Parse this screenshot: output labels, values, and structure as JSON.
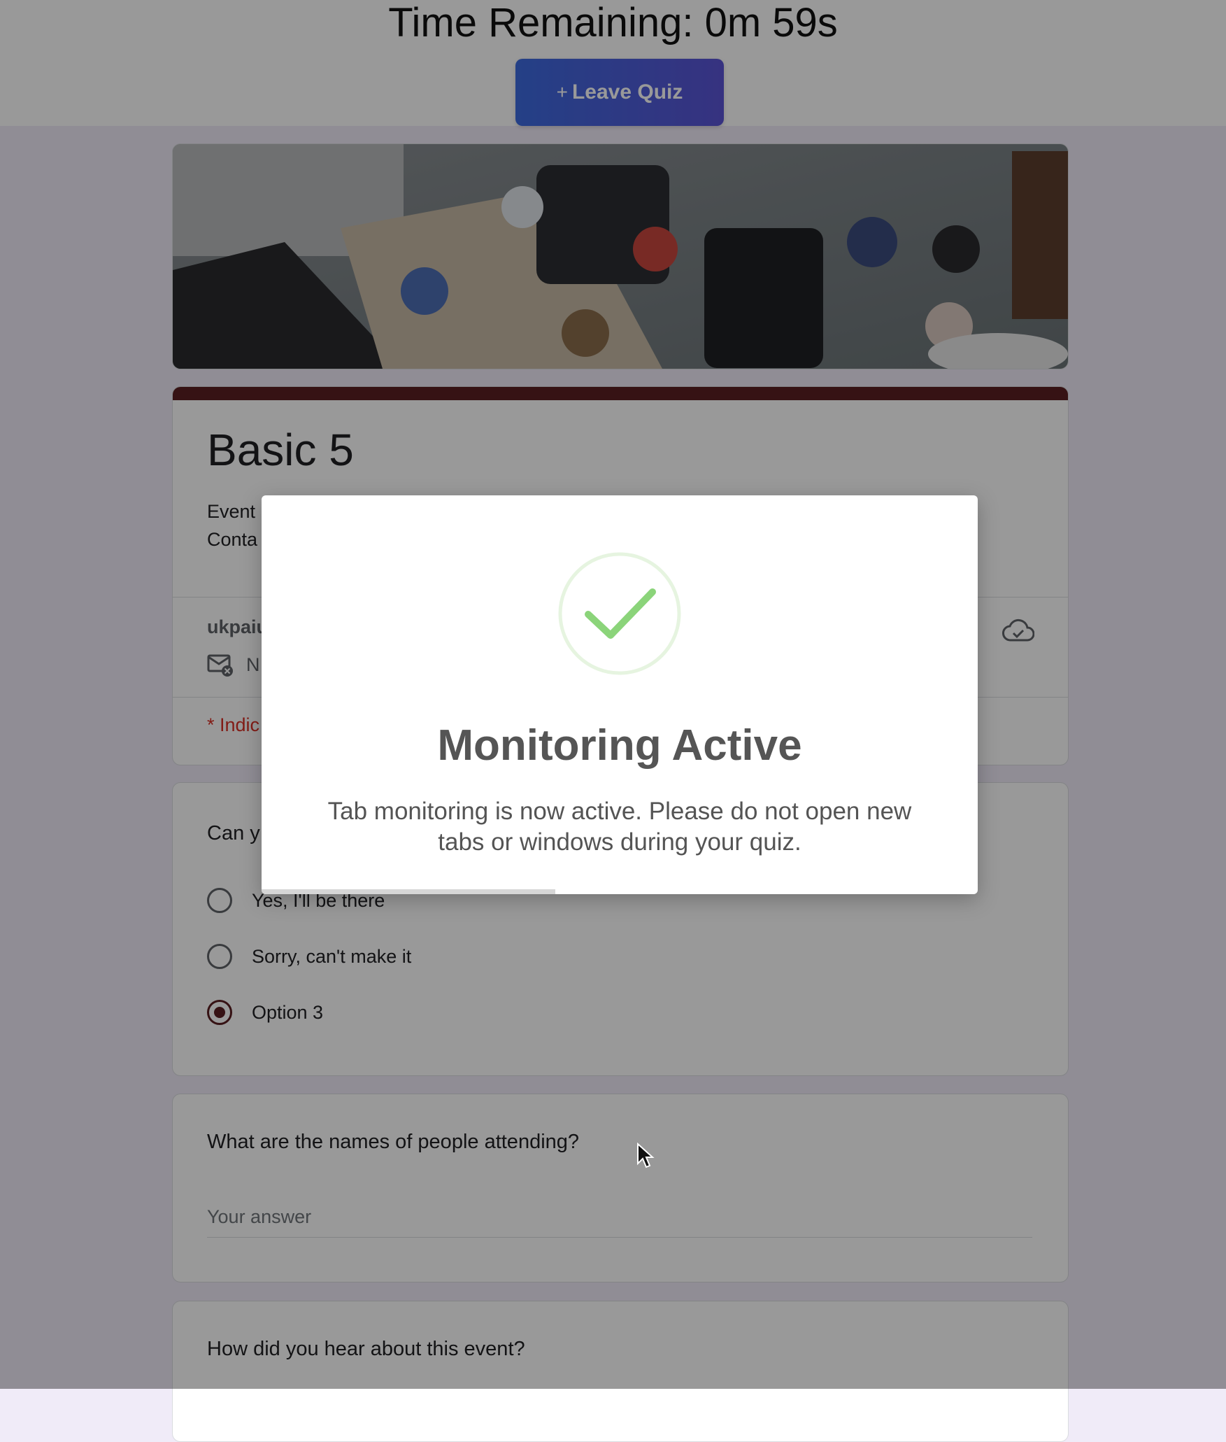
{
  "timer": {
    "text": "Time Remaining: 0m 59s"
  },
  "leave_button": {
    "plus": "+",
    "label": "Leave Quiz"
  },
  "form": {
    "title": "Basic 5",
    "description_visible": "Event\nConta",
    "account_visible": "ukpaiu",
    "email_note_visible": "N",
    "required_note_visible": "* Indic"
  },
  "questions": [
    {
      "title_visible": "Can y",
      "options": [
        {
          "label": "Yes,  I'll be there",
          "checked": false
        },
        {
          "label": "Sorry, can't make it",
          "checked": false
        },
        {
          "label": "Option 3",
          "checked": true
        }
      ]
    },
    {
      "title": "What are the names of people attending?",
      "placeholder": "Your answer"
    },
    {
      "title": "How did you hear about this event?"
    }
  ],
  "modal": {
    "title": "Monitoring Active",
    "message": "Tab monitoring is now active. Please do not open new tabs or windows during your quiz.",
    "progress_fraction": 0.41
  },
  "colors": {
    "accent": "#5a1e22",
    "button_start": "#3d6be0",
    "button_end": "#5b54d6",
    "check": "#8bd47a"
  }
}
